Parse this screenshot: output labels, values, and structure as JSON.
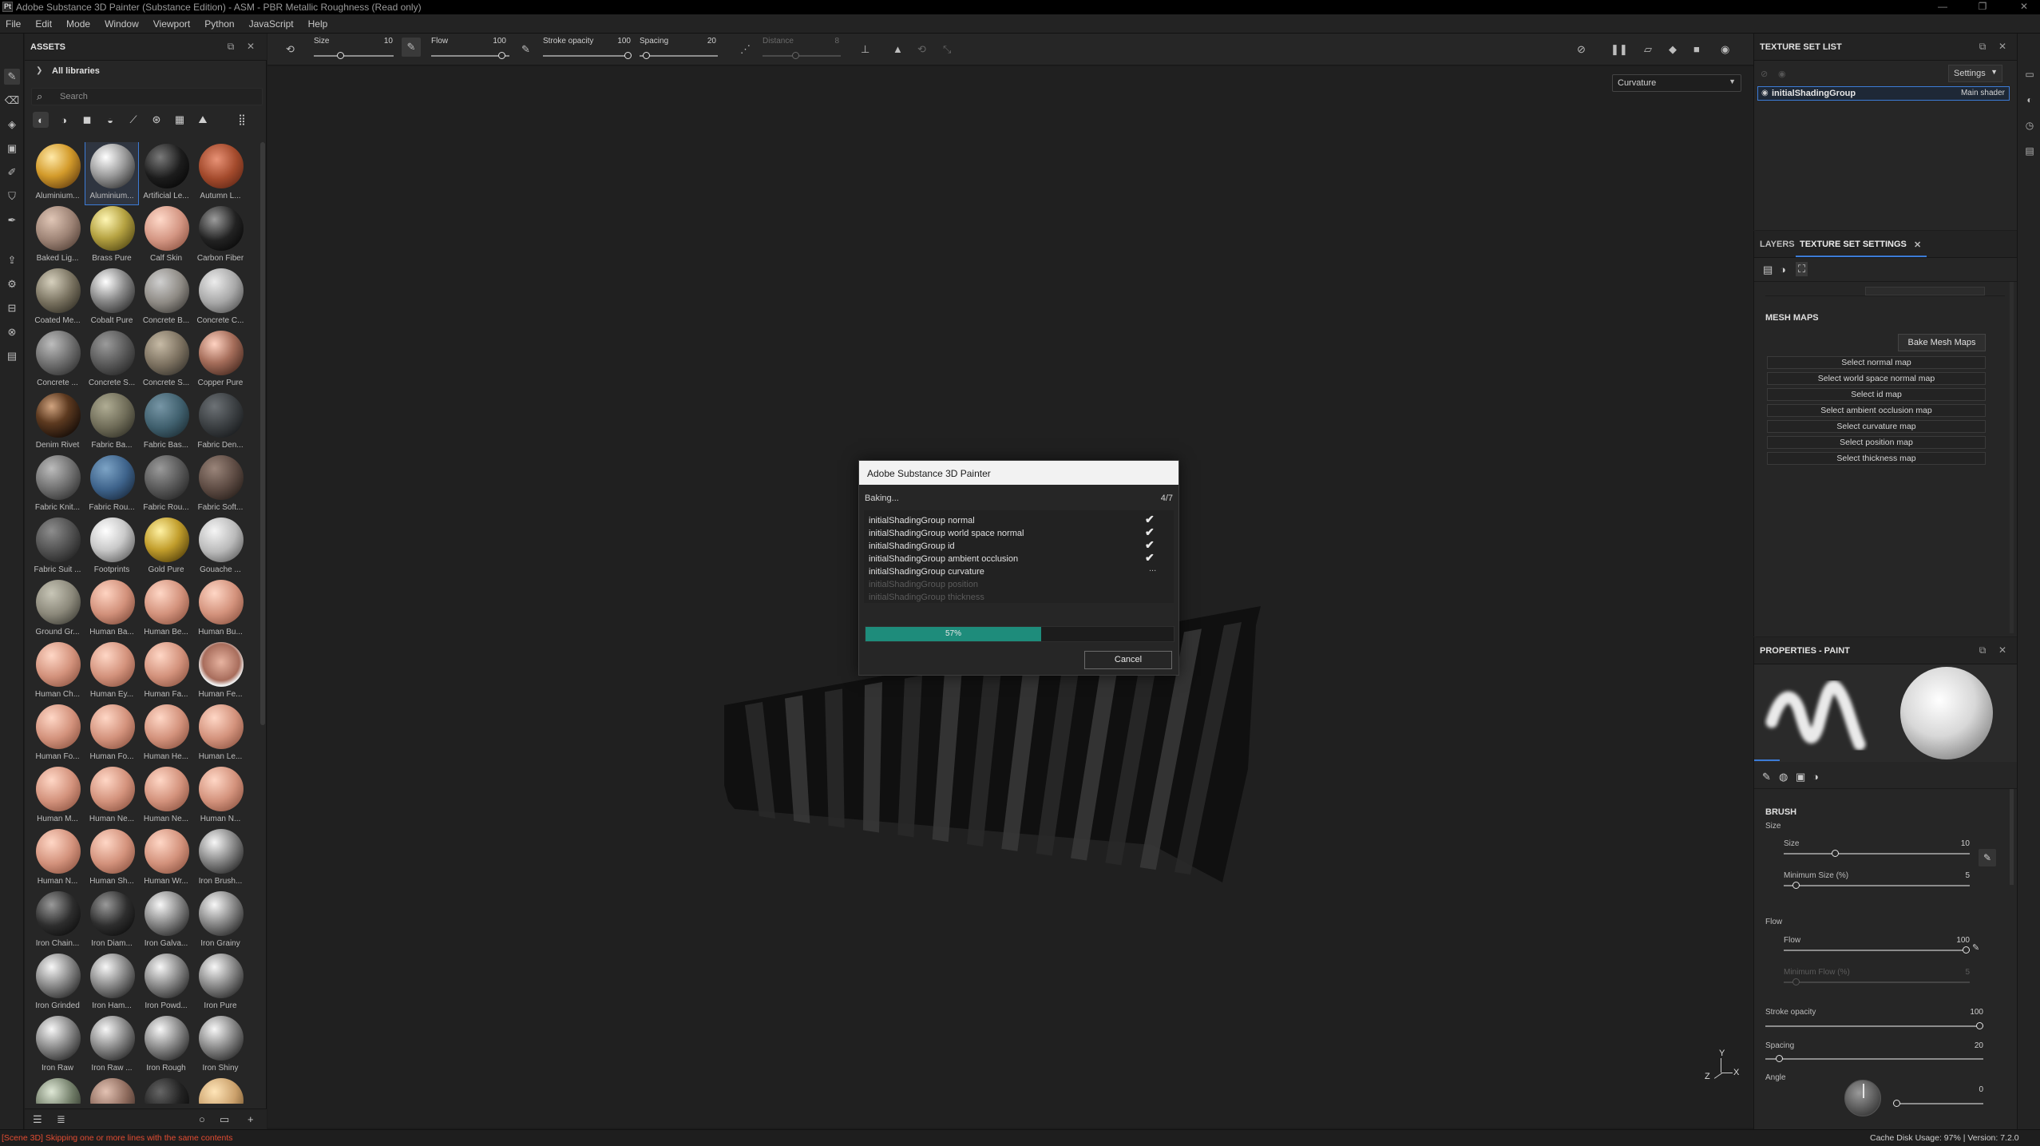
{
  "window": {
    "title": "Adobe Substance 3D Painter (Substance Edition) - ASM - PBR Metallic Roughness (Read only)",
    "icon_text": "Pt"
  },
  "menu": [
    "File",
    "Edit",
    "Mode",
    "Window",
    "Viewport",
    "Python",
    "JavaScript",
    "Help"
  ],
  "assets": {
    "title": "ASSETS",
    "library": "All libraries",
    "search_placeholder": "Search",
    "items": [
      "Aluminium...",
      "Aluminium...",
      "Artificial Le...",
      "Autumn L...",
      "Baked Lig...",
      "Brass Pure",
      "Calf Skin",
      "Carbon Fiber",
      "Coated Me...",
      "Cobalt Pure",
      "Concrete B...",
      "Concrete C...",
      "Concrete ...",
      "Concrete S...",
      "Concrete S...",
      "Copper Pure",
      "Denim Rivet",
      "Fabric Ba...",
      "Fabric Bas...",
      "Fabric Den...",
      "Fabric Knit...",
      "Fabric Rou...",
      "Fabric Rou...",
      "Fabric Soft...",
      "Fabric Suit ...",
      "Footprints",
      "Gold Pure",
      "Gouache ...",
      "Ground Gr...",
      "Human Ba...",
      "Human Be...",
      "Human Bu...",
      "Human Ch...",
      "Human Ey...",
      "Human Fa...",
      "Human Fe...",
      "Human Fo...",
      "Human Fo...",
      "Human He...",
      "Human Le...",
      "Human M...",
      "Human Ne...",
      "Human Ne...",
      "Human N...",
      "Human N...",
      "Human Sh...",
      "Human Wr...",
      "Iron Brush...",
      "Iron Chain...",
      "Iron Diam...",
      "Iron Galva...",
      "Iron Grainy",
      "Iron Grinded",
      "Iron Ham...",
      "Iron Powd...",
      "Iron Pure",
      "Iron Raw",
      "Iron Raw ...",
      "Iron Rough",
      "Iron Shiny",
      "",
      "",
      "",
      ""
    ],
    "selected_index": 1
  },
  "toolbar": {
    "size_label": "Size",
    "size_value": "10",
    "flow_label": "Flow",
    "flow_value": "100",
    "stroke_label": "Stroke opacity",
    "stroke_value": "100",
    "spacing_label": "Spacing",
    "spacing_value": "20",
    "distance_label": "Distance",
    "distance_value": "8"
  },
  "viewport": {
    "channel": "Curvature",
    "axis_labels": {
      "x": "X",
      "y": "Y",
      "z": "Z"
    }
  },
  "dialog": {
    "title": "Adobe Substance 3D Painter",
    "status": "Baking...",
    "counter": "4/7",
    "tasks": [
      {
        "label": "initialShadingGroup normal",
        "state": "done"
      },
      {
        "label": "initialShadingGroup world space normal",
        "state": "done"
      },
      {
        "label": "initialShadingGroup id",
        "state": "done"
      },
      {
        "label": "initialShadingGroup ambient occlusion",
        "state": "done"
      },
      {
        "label": "initialShadingGroup curvature",
        "state": "running"
      },
      {
        "label": "initialShadingGroup position",
        "state": "pending"
      },
      {
        "label": "initialShadingGroup thickness",
        "state": "pending"
      }
    ],
    "progress": 0.57,
    "progress_text": "57%",
    "cancel": "Cancel"
  },
  "texture_set_list": {
    "title": "TEXTURE SET LIST",
    "settings": "Settings",
    "row": {
      "name": "initialShadingGroup",
      "shader": "Main shader"
    }
  },
  "texture_set_settings": {
    "tabs": [
      "LAYERS",
      "TEXTURE SET SETTINGS"
    ],
    "section": "MESH MAPS",
    "bake_button": "Bake Mesh Maps",
    "maps": [
      "Select normal map",
      "Select world space normal map",
      "Select id map",
      "Select ambient occlusion map",
      "Select curvature map",
      "Select position map",
      "Select thickness map"
    ]
  },
  "properties": {
    "title": "PROPERTIES - PAINT",
    "brush_section": "BRUSH",
    "size_group": "Size",
    "size_label": "Size",
    "size_value": "10",
    "size_fraction": 0.27,
    "min_size_label": "Minimum Size (%)",
    "min_size_value": "5",
    "min_size_fraction": 0.05,
    "flow_group": "Flow",
    "flow_label": "Flow",
    "flow_value": "100",
    "flow_fraction": 1.0,
    "min_flow_label": "Minimum Flow (%)",
    "min_flow_value": "5",
    "min_flow_fraction": 0.05,
    "stroke_label": "Stroke opacity",
    "stroke_value": "100",
    "stroke_fraction": 1.0,
    "spacing_label": "Spacing",
    "spacing_value": "20",
    "spacing_fraction": 0.05,
    "angle_label": "Angle",
    "angle_value": "0"
  },
  "statusbar": {
    "message": "[Scene 3D] Skipping one or more lines with the same contents",
    "cache": "Cache Disk Usage:    97% | Version: 7.2.0"
  },
  "colors": {
    "accent": "#3c7bd6",
    "progress": "#1e8c7b",
    "error": "#e34c32"
  }
}
